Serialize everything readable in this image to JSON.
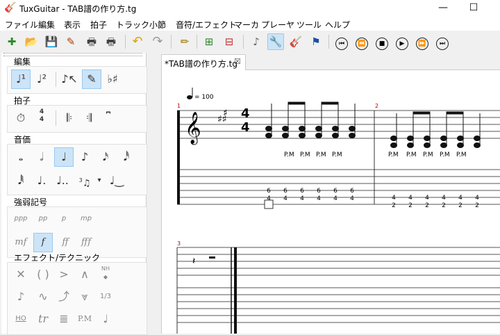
{
  "window": {
    "title": "TuxGuitar - TAB譜の作り方.tg",
    "minimize": "—",
    "maximize": "☐"
  },
  "menu": [
    "ファイル",
    "編集",
    "表示",
    "拍子",
    "トラック",
    "小節",
    "音符/エフェクト",
    "マーカ",
    "プレーヤ",
    "ツール",
    "ヘルプ"
  ],
  "toolbar": {
    "icons": [
      "new-file-icon",
      "open-file-icon",
      "save-icon",
      "edit-properties-icon",
      "print-icon",
      "print-preview-icon",
      "undo-icon",
      "redo-icon",
      "pencil-icon",
      "add-track-icon",
      "remove-track-icon",
      "note-mode-icon",
      "settings-icon",
      "guitar-icon",
      "flag-icon",
      "first-icon",
      "previous-icon",
      "stop-icon",
      "play-icon",
      "next-icon",
      "last-icon"
    ]
  },
  "palette": {
    "edit": {
      "label": "編集"
    },
    "time": {
      "label": "拍子",
      "timesig_top": "4",
      "timesig_bottom": "4"
    },
    "duration": {
      "label": "音価",
      "tuplet_mark": "3"
    },
    "dynamics": {
      "label": "強弱記号",
      "marks": [
        "ppp",
        "pp",
        "p",
        "mp",
        "mf",
        "f",
        "ff",
        "fff"
      ]
    },
    "effects": {
      "label": "エフェクト/テクニック",
      "nh_label": "NH",
      "fraction_label": "1/3",
      "ho_label": "HO",
      "tr_label": "tr",
      "pm_label": "P.M"
    }
  },
  "tab": {
    "label": "*TAB譜の作り方.tg",
    "close": "☒"
  },
  "score": {
    "tempo": "= 100",
    "timesig": {
      "top": "4",
      "bottom": "4"
    },
    "measures": [
      {
        "number": "1",
        "pm_labels": [
          "P.M",
          "P.M",
          "P.M",
          "P.M"
        ],
        "tab_top": [
          "6",
          "6",
          "6",
          "6",
          "6",
          "6"
        ],
        "tab_bottom": [
          "4",
          "4",
          "4",
          "4",
          "4",
          "4"
        ]
      },
      {
        "number": "2",
        "pm_labels": [
          "P.M",
          "P.M",
          "P.M",
          "P.M",
          "P.M"
        ],
        "tab_top": [
          "4",
          "4",
          "4",
          "4",
          "4",
          "4"
        ],
        "tab_bottom": [
          "2",
          "2",
          "2",
          "2",
          "2",
          "2"
        ]
      },
      {
        "number": "3"
      }
    ]
  }
}
